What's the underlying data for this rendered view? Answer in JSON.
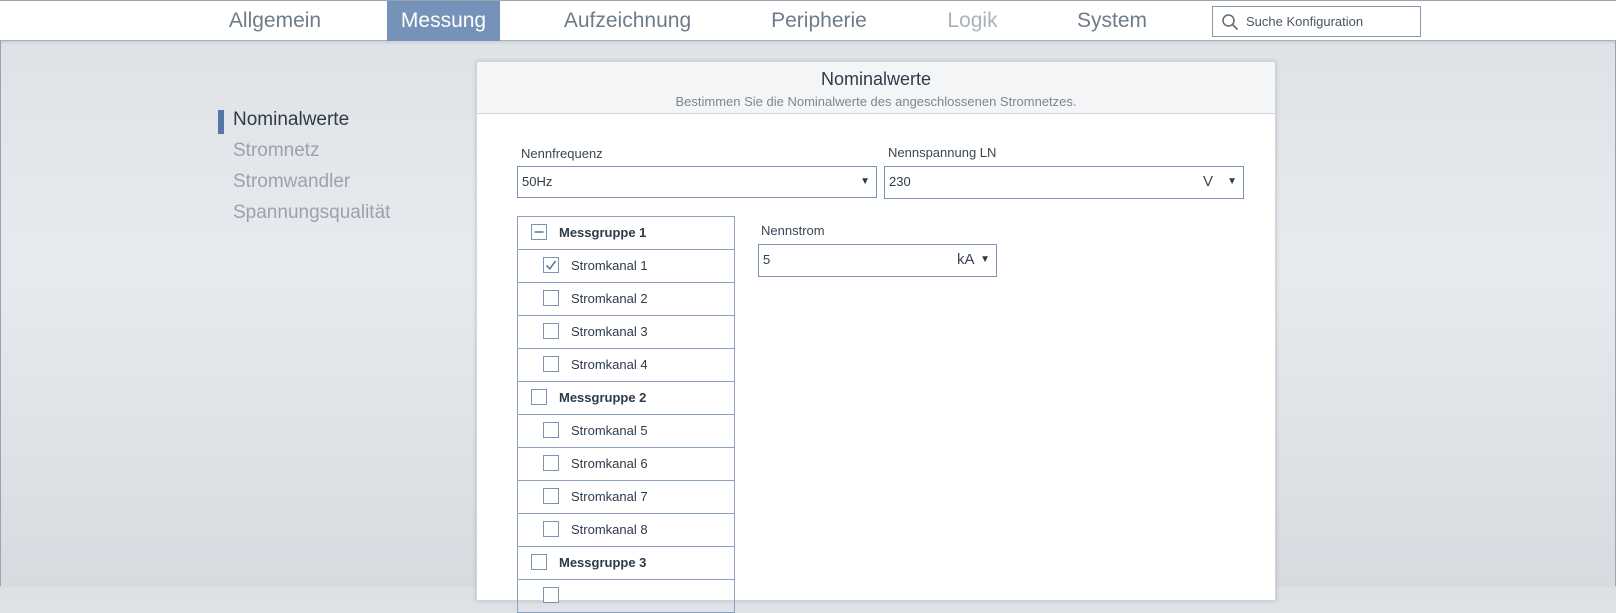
{
  "nav": {
    "tabs": [
      {
        "label": "Allgemein",
        "state": "normal"
      },
      {
        "label": "Messung",
        "state": "active"
      },
      {
        "label": "Aufzeichnung",
        "state": "normal"
      },
      {
        "label": "Peripherie",
        "state": "normal"
      },
      {
        "label": "Logik",
        "state": "disabled"
      },
      {
        "label": "System",
        "state": "normal"
      }
    ],
    "search": {
      "placeholder": "Suche Konfiguration",
      "value": ""
    }
  },
  "sidebar": {
    "items": [
      {
        "label": "Nominalwerte",
        "active": true
      },
      {
        "label": "Stromnetz",
        "active": false
      },
      {
        "label": "Stromwandler",
        "active": false
      },
      {
        "label": "Spannungsqualität",
        "active": false
      }
    ]
  },
  "panel": {
    "title": "Nominalwerte",
    "subtitle": "Bestimmen Sie die Nominalwerte des angeschlossenen Stromnetzes.",
    "nennfrequenz": {
      "label": "Nennfrequenz",
      "value": "50Hz"
    },
    "nennspannung": {
      "label": "Nennspannung LN",
      "value": "230",
      "unit": "V"
    },
    "nennstrom": {
      "label": "Nennstrom",
      "value": "5",
      "unit": "kA"
    }
  },
  "tree": {
    "rows": [
      {
        "type": "group",
        "label": "Messgruppe 1",
        "state": "indeterminate"
      },
      {
        "type": "channel",
        "label": "Stromkanal 1",
        "state": "checked"
      },
      {
        "type": "channel",
        "label": "Stromkanal 2",
        "state": "unchecked"
      },
      {
        "type": "channel",
        "label": "Stromkanal 3",
        "state": "unchecked"
      },
      {
        "type": "channel",
        "label": "Stromkanal 4",
        "state": "unchecked"
      },
      {
        "type": "group",
        "label": "Messgruppe 2",
        "state": "unchecked"
      },
      {
        "type": "channel",
        "label": "Stromkanal 5",
        "state": "unchecked"
      },
      {
        "type": "channel",
        "label": "Stromkanal 6",
        "state": "unchecked"
      },
      {
        "type": "channel",
        "label": "Stromkanal 7",
        "state": "unchecked"
      },
      {
        "type": "channel",
        "label": "Stromkanal 8",
        "state": "unchecked"
      },
      {
        "type": "group",
        "label": "Messgruppe 3",
        "state": "unchecked"
      },
      {
        "type": "channel",
        "label": "",
        "state": "unchecked"
      }
    ]
  },
  "colors": {
    "accent": "#7593b8",
    "marker": "#5478a6",
    "border": "#7a93b3"
  }
}
